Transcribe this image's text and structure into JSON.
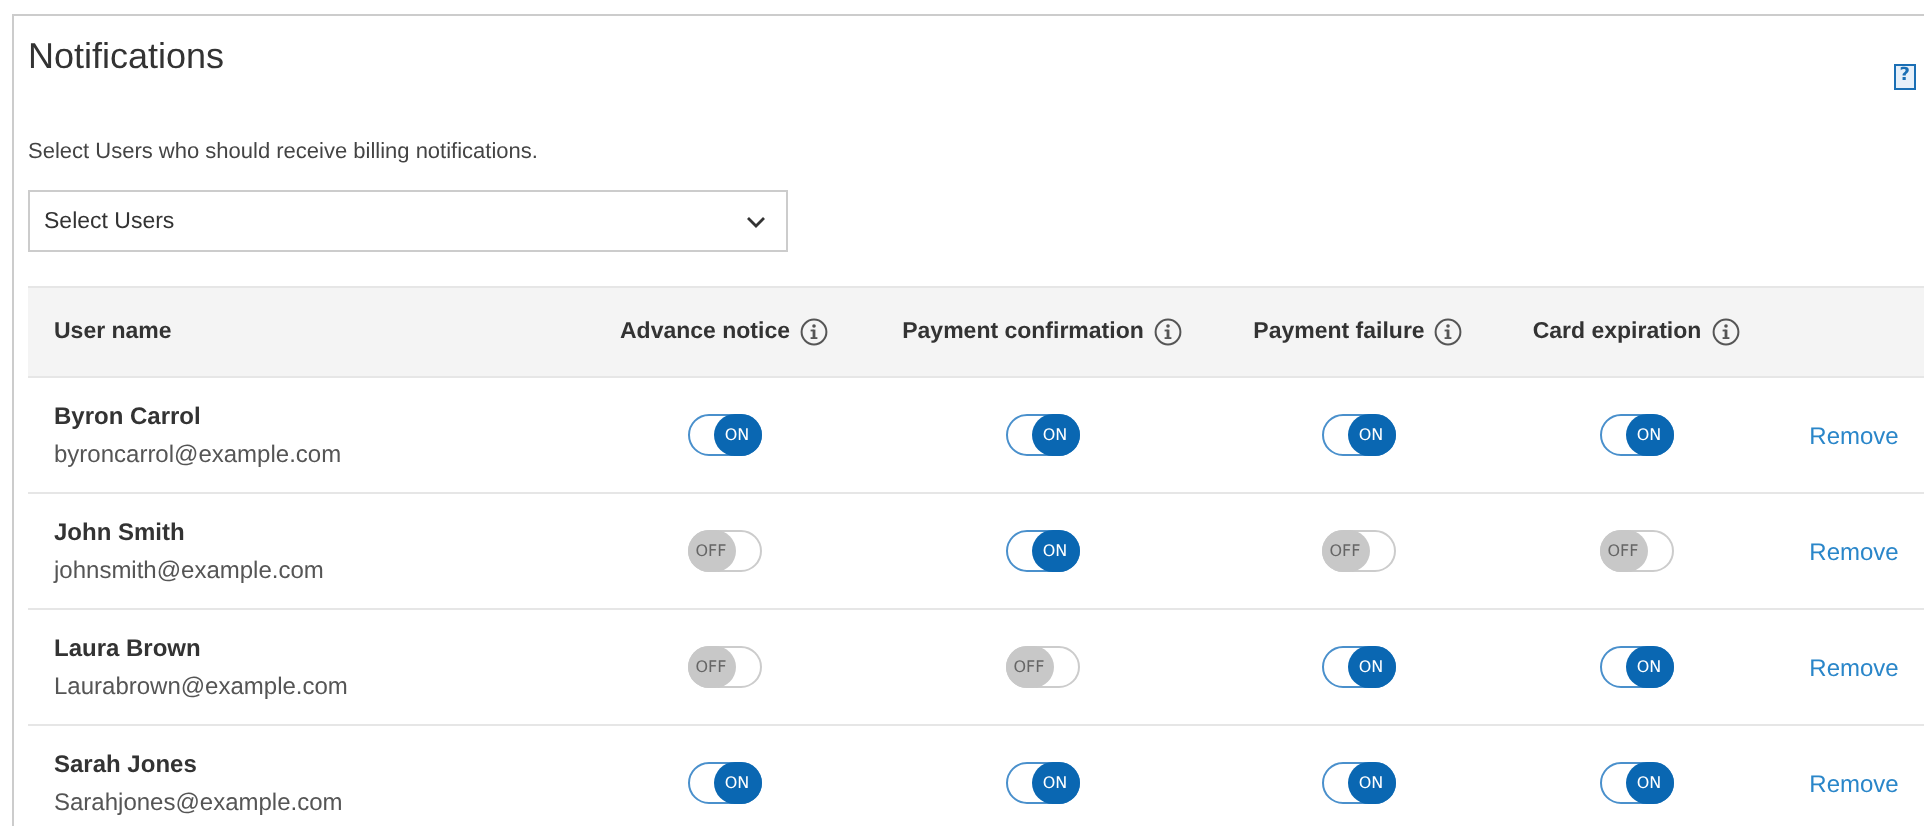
{
  "panel": {
    "title": "Notifications",
    "help": "?"
  },
  "intro": "Select Users who should receive billing notifications.",
  "user_select": {
    "placeholder": "Select Users"
  },
  "table": {
    "columns": [
      "User name",
      "Advance notice",
      "Payment confirmation",
      "Payment failure",
      "Card expiration"
    ],
    "rows": [
      {
        "name": "Byron Carrol",
        "email": "byroncarrol@example.com",
        "toggles": [
          {
            "on": true,
            "label": "ON"
          },
          {
            "on": true,
            "label": "ON"
          },
          {
            "on": true,
            "label": "ON"
          },
          {
            "on": true,
            "label": "ON"
          }
        ],
        "action": "Remove"
      },
      {
        "name": "John Smith",
        "email": "johnsmith@example.com",
        "toggles": [
          {
            "on": false,
            "label": "OFF"
          },
          {
            "on": true,
            "label": "ON"
          },
          {
            "on": false,
            "label": "OFF"
          },
          {
            "on": false,
            "label": "OFF"
          }
        ],
        "action": "Remove"
      },
      {
        "name": "Laura Brown",
        "email": "Laurabrown@example.com",
        "toggles": [
          {
            "on": false,
            "label": "OFF"
          },
          {
            "on": false,
            "label": "OFF"
          },
          {
            "on": true,
            "label": "ON"
          },
          {
            "on": true,
            "label": "ON"
          }
        ],
        "action": "Remove"
      },
      {
        "name": "Sarah Jones",
        "email": "Sarahjones@example.com",
        "toggles": [
          {
            "on": true,
            "label": "ON"
          },
          {
            "on": true,
            "label": "ON"
          },
          {
            "on": true,
            "label": "ON"
          },
          {
            "on": true,
            "label": "ON"
          }
        ],
        "action": "Remove"
      }
    ]
  }
}
